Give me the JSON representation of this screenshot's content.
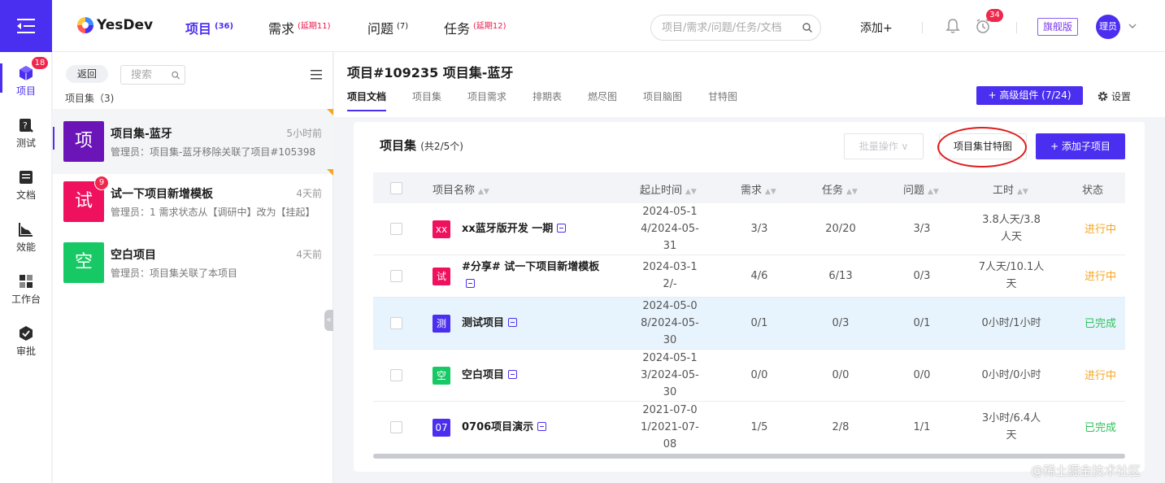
{
  "topbar": {
    "logo_text": "YesDev",
    "nav": [
      {
        "label": "项目",
        "badge": "(36)"
      },
      {
        "label": "需求",
        "badge": "(延期11)"
      },
      {
        "label": "问题",
        "badge": "(7)"
      },
      {
        "label": "任务",
        "badge": "(延期12)"
      }
    ],
    "search_placeholder": "项目/需求/问题/任务/文档",
    "add_label": "添加+",
    "clock_badge": "34",
    "edition": "旗舰版",
    "avatar": "理员"
  },
  "rail": {
    "items": [
      {
        "label": "项目",
        "icon": "cube-icon",
        "badge": "18"
      },
      {
        "label": "测试",
        "icon": "test-icon"
      },
      {
        "label": "文档",
        "icon": "document-icon"
      },
      {
        "label": "效能",
        "icon": "chart-icon"
      },
      {
        "label": "工作台",
        "icon": "dashboard-icon"
      },
      {
        "label": "审批",
        "icon": "approval-icon"
      }
    ]
  },
  "list": {
    "back": "返回",
    "search_placeholder": "搜索",
    "header": "项目集（3)",
    "items": [
      {
        "avatar": "项",
        "color": "#6b15b8",
        "title": "项目集-蓝牙",
        "time": "5小时前",
        "desc": "管理员：项目集-蓝牙移除关联了项目#105398"
      },
      {
        "avatar": "试",
        "color": "#f0115e",
        "badge": "9",
        "title": "试一下项目新增模板",
        "time": "4天前",
        "desc": "管理员：1 需求状态从【调研中】改为【挂起】"
      },
      {
        "avatar": "空",
        "color": "#17c964",
        "title": "空白项目",
        "time": "4天前",
        "desc": "管理员：项目集关联了本项目"
      }
    ]
  },
  "main": {
    "title": "项目#109235 项目集-蓝牙",
    "tabs": [
      "项目文档",
      "项目集",
      "项目需求",
      "排期表",
      "燃尽图",
      "项目脑图",
      "甘特图"
    ],
    "advanced_btn": "+ 高级组件 (7/24)",
    "settings": "设置"
  },
  "card": {
    "title": "项目集",
    "count": "(共2/5个)",
    "batch_btn": "批量操作 ∨",
    "gantt_btn": "项目集甘特图",
    "add_sub_btn": "+ 添加子项目",
    "columns": [
      "项目名称",
      "起止时间",
      "需求",
      "任务",
      "问题",
      "工时",
      "状态"
    ],
    "rows": [
      {
        "icon": "xx",
        "color": "#f0115e",
        "name": "xx蓝牙版开发 一期",
        "date": [
          "2024-05-1",
          "4/2024-05-",
          "31"
        ],
        "req": "3/3",
        "task": "20/20",
        "issue": "3/3",
        "hours": [
          "3.8人天/3.8",
          "人天"
        ],
        "status": "进行中",
        "status_color": "#f5a623"
      },
      {
        "icon": "试",
        "color": "#f0115e",
        "name": "#分享# 试一下项目新增模板",
        "date": [
          "2024-03-1",
          "2/-"
        ],
        "req": "4/6",
        "task": "6/13",
        "issue": "0/3",
        "hours": [
          "7人天/10.1人",
          "天"
        ],
        "status": "进行中",
        "status_color": "#f5a623"
      },
      {
        "icon": "测",
        "color": "#4b2ff0",
        "name": "测试项目",
        "date": [
          "2024-05-0",
          "8/2024-05-",
          "30"
        ],
        "req": "0/1",
        "task": "0/3",
        "issue": "0/1",
        "hours": [
          "0小时/1小时"
        ],
        "status": "已完成",
        "status_color": "#2fc25b"
      },
      {
        "icon": "空",
        "color": "#17c964",
        "name": "空白项目",
        "date": [
          "2024-05-1",
          "3/2024-05-",
          "30"
        ],
        "req": "0/0",
        "task": "0/0",
        "issue": "0/0",
        "hours": [
          "0小时/0小时"
        ],
        "status": "进行中",
        "status_color": "#f5a623"
      },
      {
        "icon": "07",
        "color": "#4b2ff0",
        "name": "0706项目演示",
        "date": [
          "2021-07-0",
          "1/2021-07-",
          "08"
        ],
        "req": "1/5",
        "task": "2/8",
        "issue": "1/1",
        "hours": [
          "3小时/6.4人",
          "天"
        ],
        "status": "已完成",
        "status_color": "#2fc25b"
      }
    ]
  },
  "watermark": "@稀土掘金技术社区"
}
